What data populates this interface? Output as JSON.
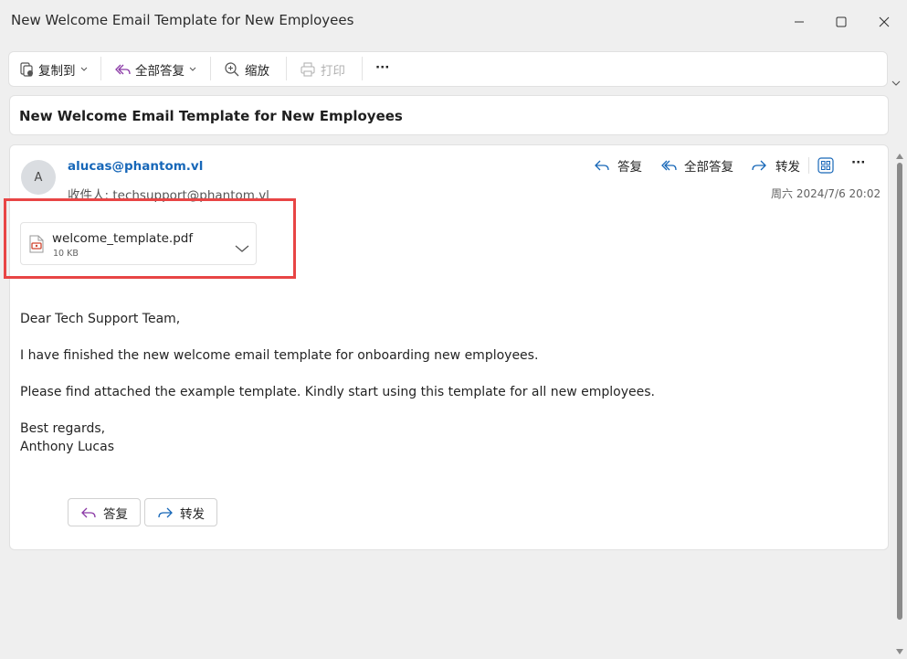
{
  "window": {
    "title": "New Welcome Email Template for New Employees",
    "minimize_icon": "minimize-icon",
    "maximize_icon": "maximize-icon",
    "close_icon": "close-icon"
  },
  "toolbar": {
    "copy_to": "复制到",
    "reply_all": "全部答复",
    "zoom": "缩放",
    "print": "打印",
    "more": "···"
  },
  "message": {
    "subject": "New Welcome Email Template for New Employees",
    "avatar_initial": "A",
    "sender": "alucas@phantom.vl",
    "recipients": "收件人:  techsupport@phantom.vl",
    "date": "周六 2024/7/6 20:02",
    "actions": {
      "reply": "答复",
      "reply_all": "全部答复",
      "forward": "转发",
      "more": "···"
    },
    "attachment": {
      "name": "welcome_template.pdf",
      "size": "10 KB"
    },
    "body": [
      "Dear Tech Support Team,",
      "I have finished the new welcome email template for onboarding new employees.",
      "Please find attached the example template. Kindly start using this template for all new employees.",
      "Best regards,",
      "Anthony Lucas"
    ],
    "footer": {
      "reply": "答复",
      "forward": "转发"
    }
  },
  "colors": {
    "accent": "#1767b8",
    "highlight": "#e84545",
    "reply_purple": "#8b3aa6"
  }
}
